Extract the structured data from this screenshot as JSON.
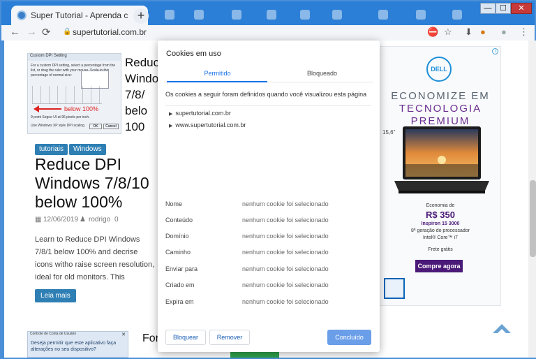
{
  "browser": {
    "tab_title": "Super Tutorial - Aprenda com tu",
    "tab_close": "✕",
    "new_tab": "+",
    "url": "supertutorial.com.br",
    "window_controls": {
      "minimize": "—",
      "maximize": "☐",
      "close": "✕"
    },
    "window_close_color": "#c83a3a",
    "back": "←",
    "forward": "→",
    "reload": "⟳",
    "icons": [
      "lock-icon",
      "cookie-blocked-icon",
      "star-icon",
      "download-icon",
      "extension-icon",
      "profile-icon",
      "menu-icon"
    ]
  },
  "post": {
    "side_title_lines": [
      "Reduc",
      "Windo",
      "7/8/",
      "belo",
      "100"
    ],
    "tags": [
      "tutoriais",
      "Windows"
    ],
    "title": "Reduce DPI Windows 7/8/10 below 100%",
    "date": "12/06/2019",
    "author": "rodrigo",
    "comments": "0",
    "excerpt": "Learn to Reduce DPI Windows 7/8/1 below 100% and decrise icons witho raise screen resolution, ideal for old monitors. This",
    "read_more": "Leia mais",
    "thumb": {
      "window_title": "Custom DPI Setting",
      "text": "For a custom DPI setting, select a percentage from the list, or drag the ruler with your mouse. Scale to this percentage of normal size:",
      "red_label": "below 100%",
      "footer": "9 point Segoe UI at 96 pixels per inch.",
      "checkbox": "Use Windows XP style DPI scaling",
      "ok": "OK",
      "cancel": "Cancel"
    },
    "second_thumb": {
      "title": "Controle de Conta de Usuário",
      "question": "Deseja permitir que este aplicativo faça alterações no seu dispositivo?",
      "close": "✕"
    },
    "second_title": "For"
  },
  "ad": {
    "logo": "DELL",
    "info": "i",
    "line1": "ECONOMIZE EM",
    "line2": "TECNOLOGIA",
    "line3": "PREMIUM",
    "size": "15,6\"",
    "economia": "Economia de",
    "price": "R$ 350",
    "model": "Inspiron 15 3000",
    "proc1": "8ª geração do processador",
    "proc2": "Intel® Core™ i7",
    "frete": "Frete grátis",
    "cta": "Compre agora",
    "colors": {
      "gray": "#5a6470",
      "purple": "#6b2c8f",
      "price": "#4b1a78"
    }
  },
  "cookies_dialog": {
    "title": "Cookies em uso",
    "tabs": [
      "Permitido",
      "Bloqueado"
    ],
    "active_tab": "Permitido",
    "description": "Os cookies a seguir foram definidos quando você visualizou esta página",
    "sites": [
      "supertutorial.com.br",
      "www.supertutorial.com.br"
    ],
    "details": [
      {
        "label": "Nome",
        "value": "nenhum cookie foi selecionado"
      },
      {
        "label": "Conteúdo",
        "value": "nenhum cookie foi selecionado"
      },
      {
        "label": "Domínio",
        "value": "nenhum cookie foi selecionado"
      },
      {
        "label": "Caminho",
        "value": "nenhum cookie foi selecionado"
      },
      {
        "label": "Enviar para",
        "value": "nenhum cookie foi selecionado"
      },
      {
        "label": "Criado em",
        "value": "nenhum cookie foi selecionado"
      },
      {
        "label": "Expira em",
        "value": "nenhum cookie foi selecionado"
      }
    ],
    "buttons": {
      "block": "Bloquear",
      "remove": "Remover",
      "done": "Concluído"
    },
    "accent": "#1a73e8"
  }
}
